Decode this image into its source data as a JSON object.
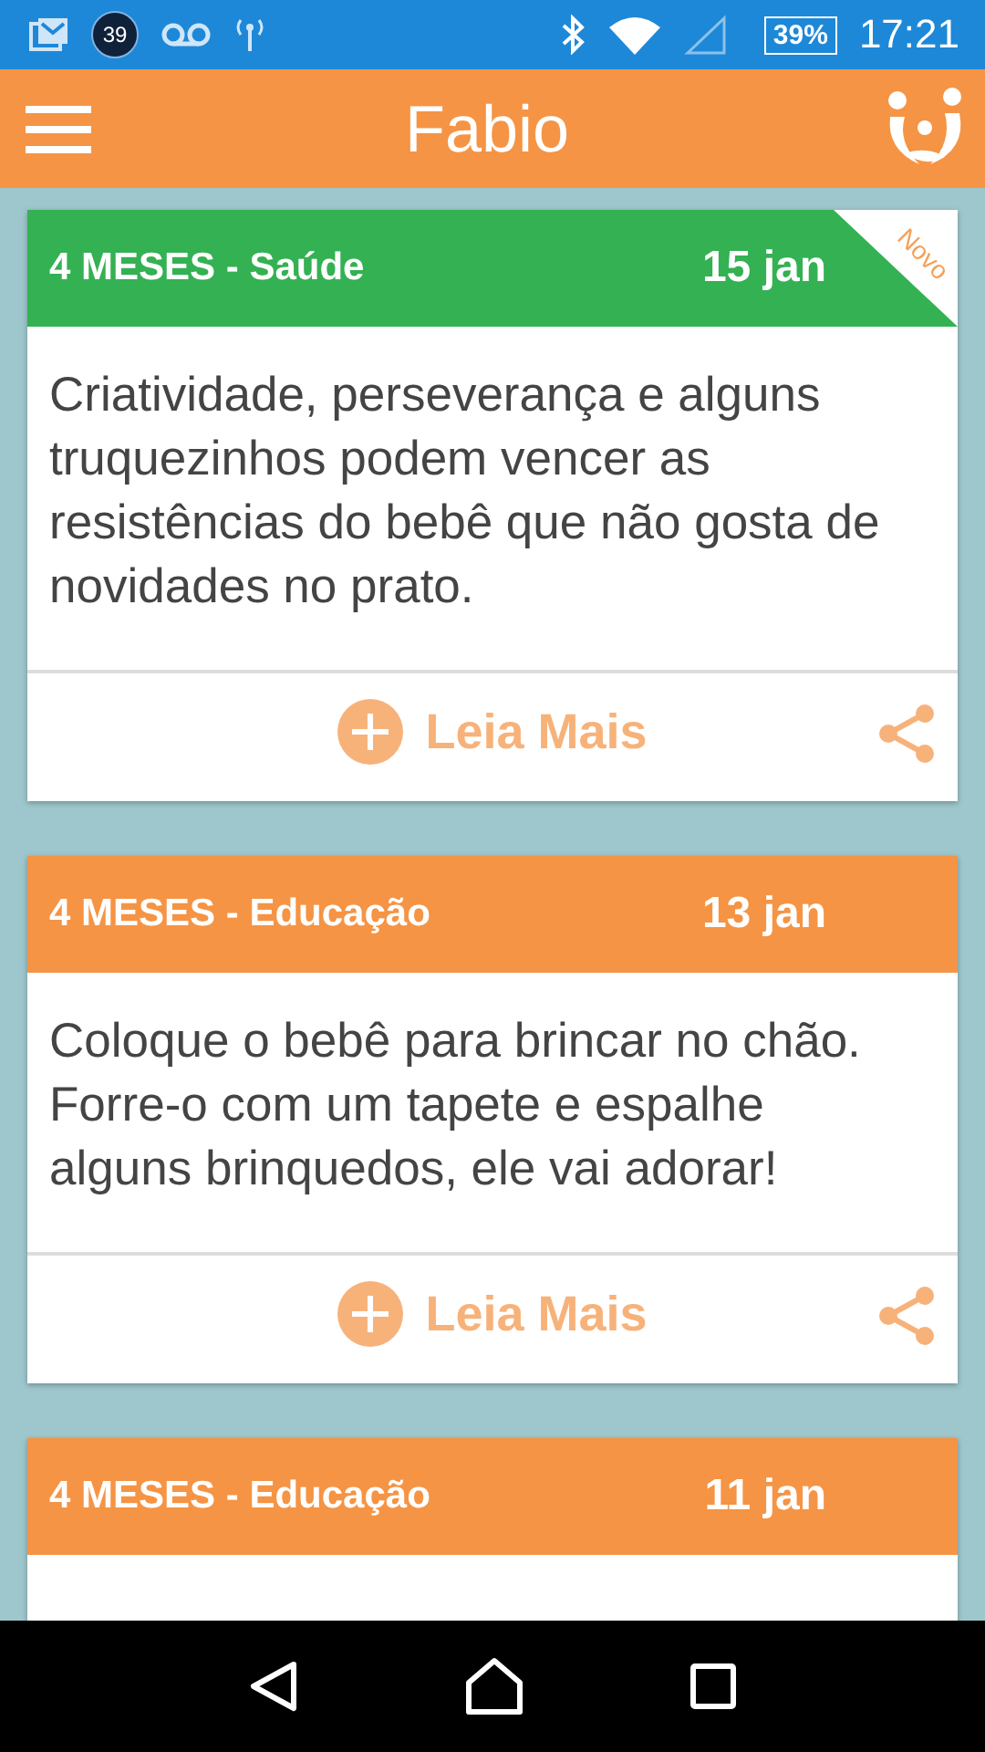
{
  "status_bar": {
    "notification_count": "39",
    "battery": "39%",
    "time": "17:21"
  },
  "app_bar": {
    "title": "Fabio"
  },
  "cards": [
    {
      "header": "4 MESES - Saúde",
      "date": "15 jan",
      "color": "#34b153",
      "new": true,
      "ribbon": "Novo",
      "text": "Criatividade, perseverança e alguns truquezinhos podem vencer as resistências do bebê que não gosta de novidades no prato.",
      "action": "Leia Mais"
    },
    {
      "header": "4 MESES - Educação",
      "date": "13 jan",
      "color": "#f59444",
      "new": false,
      "text": "Coloque o bebê para brincar no chão. Forre-o com um tapete e espalhe alguns brinquedos, ele vai adorar!",
      "action": "Leia Mais"
    },
    {
      "header": "4 MESES - Educação",
      "date": "11 jan",
      "color": "#f59444",
      "new": false
    }
  ]
}
